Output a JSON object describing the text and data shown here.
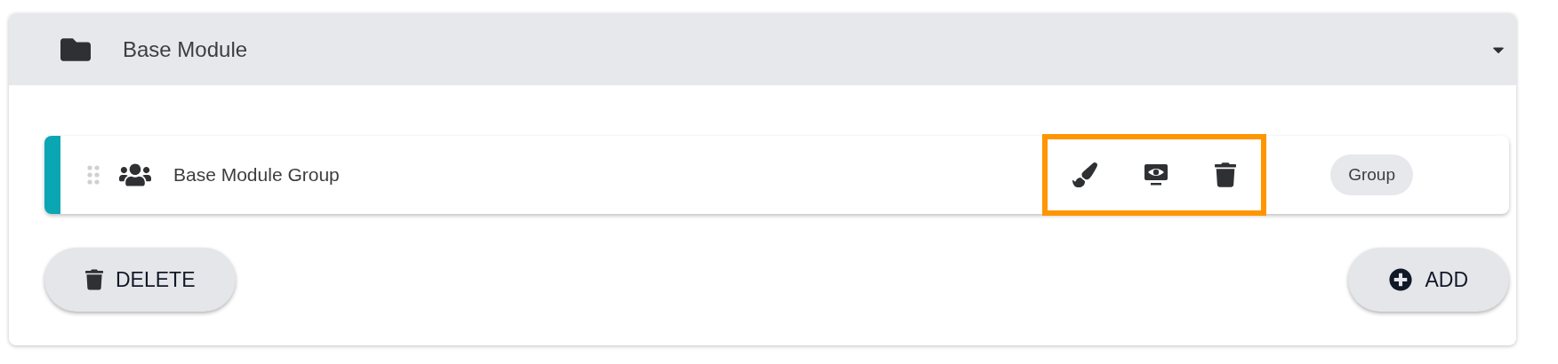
{
  "section": {
    "title": "Base Module",
    "expanded": true,
    "items": [
      {
        "name": "Base Module Group",
        "tag": "Group",
        "highlighted": true
      }
    ],
    "actions": [
      {
        "kind": "delete",
        "label": "DELETE"
      },
      {
        "kind": "add",
        "label": "ADD"
      }
    ]
  }
}
